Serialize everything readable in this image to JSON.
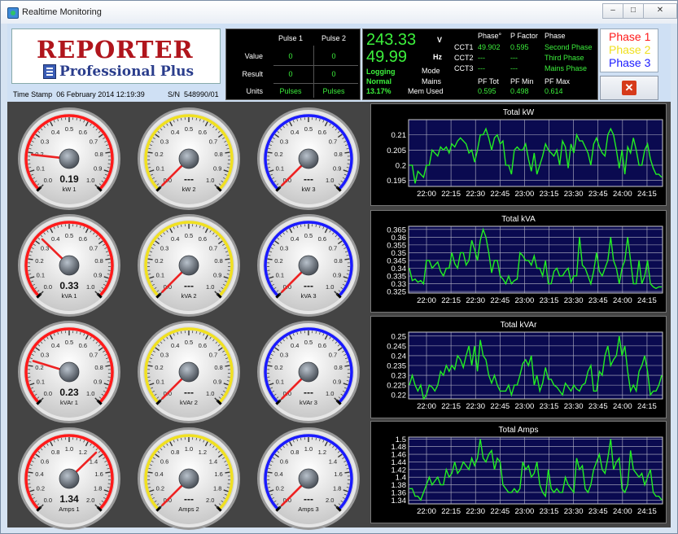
{
  "window": {
    "title": "Realtime Monitoring",
    "buttons": {
      "minimize": "–",
      "maximize": "□",
      "close": "✕"
    }
  },
  "header": {
    "logo": {
      "title": "REPORTER",
      "subtitle": "Professional Plus"
    },
    "timestamp_label": "Time Stamp",
    "timestamp_value": "06 February 2014 12:19:39",
    "serial_label": "S/N",
    "serial_value": "548990/01"
  },
  "pulse": {
    "headers": [
      "Pulse 1",
      "Pulse 2"
    ],
    "rows": [
      {
        "label": "Value",
        "p1": "0",
        "p2": "0"
      },
      {
        "label": "Result",
        "p1": "0",
        "p2": "0"
      },
      {
        "label": "Units",
        "p1": "Pulses",
        "p2": "Pulses"
      }
    ]
  },
  "status": {
    "voltage": "243.33",
    "voltage_unit": "V",
    "frequency": "49.99",
    "frequency_unit": "Hz",
    "logging": "Logging",
    "mode_label": "Mode",
    "mode_value": "Normal",
    "mains_label": "Mains",
    "mem_label": "Mem Used",
    "mem_value": "13.17%",
    "columns": {
      "phase_deg": "Phase°",
      "pfactor": "P Factor",
      "phase": "Phase"
    },
    "ccts": [
      {
        "name": "CCT1",
        "phase_deg": "49.902",
        "pfactor": "0.595",
        "phase": "Second Phase"
      },
      {
        "name": "CCT2",
        "phase_deg": "---",
        "pfactor": "---",
        "phase": "Third Phase"
      },
      {
        "name": "CCT3",
        "phase_deg": "---",
        "pfactor": "---",
        "phase": "Mains Phase"
      }
    ],
    "pf": [
      {
        "label": "PF Tot",
        "value": "0.595"
      },
      {
        "label": "PF Min",
        "value": "0.498"
      },
      {
        "label": "PF Max",
        "value": "0.614"
      }
    ]
  },
  "phases": [
    {
      "label": "Phase 1",
      "color": "#ff1a1a"
    },
    {
      "label": "Phase 2",
      "color": "#f0e020"
    },
    {
      "label": "Phase 3",
      "color": "#1a1aff"
    }
  ],
  "gauges": [
    {
      "label": "kW 1",
      "value": 0.19,
      "display": "0.19",
      "max": 1.0,
      "ticks": [
        "0.0",
        "0.1",
        "0.2",
        "0.3",
        "0.4",
        "0.5",
        "0.6",
        "0.7",
        "0.8",
        "0.9",
        "1.0"
      ],
      "ring": "#ff1a1a"
    },
    {
      "label": "kW 2",
      "value": 0.0,
      "display": "---",
      "max": 1.0,
      "ticks": [
        "0.0",
        "0.1",
        "0.2",
        "0.3",
        "0.4",
        "0.5",
        "0.6",
        "0.7",
        "0.8",
        "0.9",
        "1.0"
      ],
      "ring": "#f0e020"
    },
    {
      "label": "kW 3",
      "value": 0.0,
      "display": "---",
      "max": 1.0,
      "ticks": [
        "0.0",
        "0.1",
        "0.2",
        "0.3",
        "0.4",
        "0.5",
        "0.6",
        "0.7",
        "0.8",
        "0.9",
        "1.0"
      ],
      "ring": "#1a1aff"
    },
    {
      "label": "kVA 1",
      "value": 0.33,
      "display": "0.33",
      "max": 1.0,
      "ticks": [
        "0.0",
        "0.1",
        "0.2",
        "0.3",
        "0.4",
        "0.5",
        "0.6",
        "0.7",
        "0.8",
        "0.9",
        "1.0"
      ],
      "ring": "#ff1a1a"
    },
    {
      "label": "kVA 2",
      "value": 0.0,
      "display": "---",
      "max": 1.0,
      "ticks": [
        "0.0",
        "0.1",
        "0.2",
        "0.3",
        "0.4",
        "0.5",
        "0.6",
        "0.7",
        "0.8",
        "0.9",
        "1.0"
      ],
      "ring": "#f0e020"
    },
    {
      "label": "kVA 3",
      "value": 0.0,
      "display": "---",
      "max": 1.0,
      "ticks": [
        "0.0",
        "0.1",
        "0.2",
        "0.3",
        "0.4",
        "0.5",
        "0.6",
        "0.7",
        "0.8",
        "0.9",
        "1.0"
      ],
      "ring": "#1a1aff"
    },
    {
      "label": "kVAr 1",
      "value": 0.23,
      "display": "0.23",
      "max": 1.0,
      "ticks": [
        "0.0",
        "0.1",
        "0.2",
        "0.3",
        "0.4",
        "0.5",
        "0.6",
        "0.7",
        "0.8",
        "0.9",
        "1.0"
      ],
      "ring": "#ff1a1a"
    },
    {
      "label": "kVAr 2",
      "value": 0.0,
      "display": "---",
      "max": 1.0,
      "ticks": [
        "0.0",
        "0.1",
        "0.2",
        "0.3",
        "0.4",
        "0.5",
        "0.6",
        "0.7",
        "0.8",
        "0.9",
        "1.0"
      ],
      "ring": "#f0e020"
    },
    {
      "label": "kVAr 3",
      "value": 0.0,
      "display": "---",
      "max": 1.0,
      "ticks": [
        "0.0",
        "0.1",
        "0.2",
        "0.3",
        "0.4",
        "0.5",
        "0.6",
        "0.7",
        "0.8",
        "0.9",
        "1.0"
      ],
      "ring": "#1a1aff"
    },
    {
      "label": "Amps 1",
      "value": 1.34,
      "display": "1.34",
      "max": 2.0,
      "ticks": [
        "0.0",
        "0.2",
        "0.4",
        "0.6",
        "0.8",
        "1.0",
        "1.2",
        "1.4",
        "1.6",
        "1.8",
        "2.0"
      ],
      "ring": "#ff1a1a"
    },
    {
      "label": "Amps 2",
      "value": 0.0,
      "display": "---",
      "max": 2.0,
      "ticks": [
        "0.0",
        "0.2",
        "0.4",
        "0.6",
        "0.8",
        "1.0",
        "1.2",
        "1.4",
        "1.6",
        "1.8",
        "2.0"
      ],
      "ring": "#f0e020"
    },
    {
      "label": "Amps 3",
      "value": 0.0,
      "display": "---",
      "max": 2.0,
      "ticks": [
        "0.0",
        "0.2",
        "0.4",
        "0.6",
        "0.8",
        "1.0",
        "1.2",
        "1.4",
        "1.6",
        "1.8",
        "2.0"
      ],
      "ring": "#1a1aff"
    }
  ],
  "chart_data": [
    {
      "type": "line",
      "title": "Total kW",
      "x_ticks": [
        "22:00",
        "22:15",
        "22:30",
        "22:45",
        "23:00",
        "23:15",
        "23:30",
        "23:45",
        "24:00",
        "24:15"
      ],
      "y_ticks": [
        0.195,
        0.2,
        0.205,
        0.21
      ],
      "y_tick_labels": [
        "0.195",
        "0.2",
        "0.205",
        "0.21"
      ],
      "ylim": [
        0.193,
        0.215
      ],
      "grid": true,
      "series": [
        {
          "color": "#22ee22",
          "values": [
            0.2,
            0.2,
            0.194,
            0.198,
            0.197,
            0.196,
            0.2,
            0.2,
            0.205,
            0.204,
            0.203,
            0.206,
            0.205,
            0.206,
            0.204,
            0.207,
            0.206,
            0.208,
            0.209,
            0.208,
            0.207,
            0.204,
            0.205,
            0.201,
            0.205,
            0.21,
            0.21,
            0.212,
            0.209,
            0.205,
            0.209,
            0.21,
            0.207,
            0.208,
            0.2,
            0.2,
            0.197,
            0.205,
            0.206,
            0.205,
            0.205,
            0.207,
            0.202,
            0.198,
            0.204,
            0.197,
            0.2,
            0.203,
            0.207,
            0.205,
            0.204,
            0.203,
            0.205,
            0.2,
            0.208,
            0.206,
            0.199,
            0.207,
            0.204,
            0.21,
            0.208,
            0.208,
            0.206,
            0.204,
            0.2,
            0.207,
            0.209,
            0.206,
            0.204,
            0.203,
            0.21,
            0.212,
            0.21,
            0.205,
            0.199,
            0.205,
            0.197,
            0.206,
            0.204,
            0.209,
            0.205,
            0.2,
            0.2,
            0.205,
            0.207,
            0.202,
            0.199,
            0.197,
            0.197,
            0.196
          ]
        }
      ]
    },
    {
      "type": "line",
      "title": "Total kVA",
      "x_ticks": [
        "22:00",
        "22:15",
        "22:30",
        "22:45",
        "23:00",
        "23:15",
        "23:30",
        "23:45",
        "24:00",
        "24:15"
      ],
      "y_ticks": [
        0.325,
        0.33,
        0.335,
        0.34,
        0.345,
        0.35,
        0.355,
        0.36,
        0.365
      ],
      "y_tick_labels": [
        "0.325",
        "0.33",
        "0.335",
        "0.34",
        "0.345",
        "0.35",
        "0.355",
        "0.36",
        "0.365"
      ],
      "ylim": [
        0.324,
        0.367
      ],
      "grid": true,
      "series": [
        {
          "color": "#22ee22",
          "values": [
            0.34,
            0.332,
            0.333,
            0.331,
            0.332,
            0.33,
            0.345,
            0.345,
            0.34,
            0.342,
            0.344,
            0.338,
            0.335,
            0.34,
            0.34,
            0.35,
            0.343,
            0.34,
            0.35,
            0.35,
            0.342,
            0.345,
            0.358,
            0.352,
            0.345,
            0.358,
            0.365,
            0.36,
            0.35,
            0.337,
            0.345,
            0.345,
            0.335,
            0.333,
            0.33,
            0.335,
            0.33,
            0.332,
            0.333,
            0.35,
            0.348,
            0.345,
            0.345,
            0.342,
            0.348,
            0.34,
            0.34,
            0.335,
            0.345,
            0.33,
            0.33,
            0.338,
            0.34,
            0.335,
            0.335,
            0.338,
            0.34,
            0.331,
            0.335,
            0.335,
            0.36,
            0.342,
            0.34,
            0.335,
            0.33,
            0.338,
            0.35,
            0.338,
            0.335,
            0.34,
            0.345,
            0.36,
            0.345,
            0.34,
            0.33,
            0.34,
            0.345,
            0.36,
            0.345,
            0.33,
            0.33,
            0.345,
            0.33,
            0.335,
            0.345,
            0.33,
            0.328,
            0.327,
            0.328,
            0.328
          ]
        }
      ]
    },
    {
      "type": "line",
      "title": "Total kVAr",
      "x_ticks": [
        "22:00",
        "22:15",
        "22:30",
        "22:45",
        "23:00",
        "23:15",
        "23:30",
        "23:45",
        "24:00",
        "24:15"
      ],
      "y_ticks": [
        0.22,
        0.225,
        0.23,
        0.235,
        0.24,
        0.245,
        0.25
      ],
      "y_tick_labels": [
        "0.22",
        "0.225",
        "0.23",
        "0.235",
        "0.24",
        "0.245",
        "0.25"
      ],
      "ylim": [
        0.218,
        0.252
      ],
      "grid": true,
      "series": [
        {
          "color": "#22ee22",
          "values": [
            0.225,
            0.23,
            0.225,
            0.222,
            0.225,
            0.218,
            0.22,
            0.225,
            0.224,
            0.222,
            0.225,
            0.232,
            0.23,
            0.235,
            0.232,
            0.235,
            0.233,
            0.24,
            0.238,
            0.234,
            0.24,
            0.245,
            0.235,
            0.245,
            0.232,
            0.248,
            0.24,
            0.238,
            0.23,
            0.226,
            0.23,
            0.225,
            0.222,
            0.222,
            0.222,
            0.225,
            0.22,
            0.225,
            0.225,
            0.23,
            0.236,
            0.238,
            0.235,
            0.24,
            0.225,
            0.23,
            0.222,
            0.226,
            0.234,
            0.228,
            0.228,
            0.225,
            0.224,
            0.222,
            0.22,
            0.226,
            0.224,
            0.222,
            0.225,
            0.223,
            0.222,
            0.225,
            0.226,
            0.232,
            0.235,
            0.222,
            0.222,
            0.232,
            0.23,
            0.24,
            0.245,
            0.235,
            0.238,
            0.24,
            0.25,
            0.24,
            0.245,
            0.232,
            0.222,
            0.225,
            0.222,
            0.232,
            0.235,
            0.24,
            0.232,
            0.22,
            0.222,
            0.222,
            0.225,
            0.23
          ]
        }
      ]
    },
    {
      "type": "line",
      "title": "Total Amps",
      "x_ticks": [
        "22:00",
        "22:15",
        "22:30",
        "22:45",
        "23:00",
        "23:15",
        "23:30",
        "23:45",
        "24:00",
        "24:15"
      ],
      "y_ticks": [
        1.34,
        1.36,
        1.38,
        1.4,
        1.42,
        1.44,
        1.46,
        1.48,
        1.5
      ],
      "y_tick_labels": [
        "1.34",
        "1.36",
        "1.38",
        "1.4",
        "1.42",
        "1.44",
        "1.46",
        "1.48",
        "1.5"
      ],
      "ylim": [
        1.33,
        1.505
      ],
      "grid": true,
      "series": [
        {
          "color": "#22ee22",
          "values": [
            1.37,
            1.37,
            1.35,
            1.35,
            1.34,
            1.36,
            1.38,
            1.4,
            1.38,
            1.39,
            1.4,
            1.38,
            1.38,
            1.42,
            1.4,
            1.41,
            1.44,
            1.41,
            1.42,
            1.44,
            1.43,
            1.42,
            1.45,
            1.43,
            1.45,
            1.5,
            1.45,
            1.44,
            1.46,
            1.47,
            1.42,
            1.45,
            1.44,
            1.38,
            1.37,
            1.36,
            1.36,
            1.37,
            1.36,
            1.37,
            1.44,
            1.42,
            1.43,
            1.4,
            1.41,
            1.44,
            1.38,
            1.36,
            1.35,
            1.42,
            1.37,
            1.36,
            1.37,
            1.36,
            1.36,
            1.4,
            1.38,
            1.37,
            1.36,
            1.45,
            1.42,
            1.43,
            1.37,
            1.36,
            1.38,
            1.42,
            1.44,
            1.46,
            1.42,
            1.41,
            1.45,
            1.5,
            1.42,
            1.44,
            1.45,
            1.37,
            1.36,
            1.38,
            1.47,
            1.42,
            1.41,
            1.4,
            1.41,
            1.38,
            1.4,
            1.42,
            1.36,
            1.35,
            1.35,
            1.34
          ]
        }
      ]
    }
  ]
}
